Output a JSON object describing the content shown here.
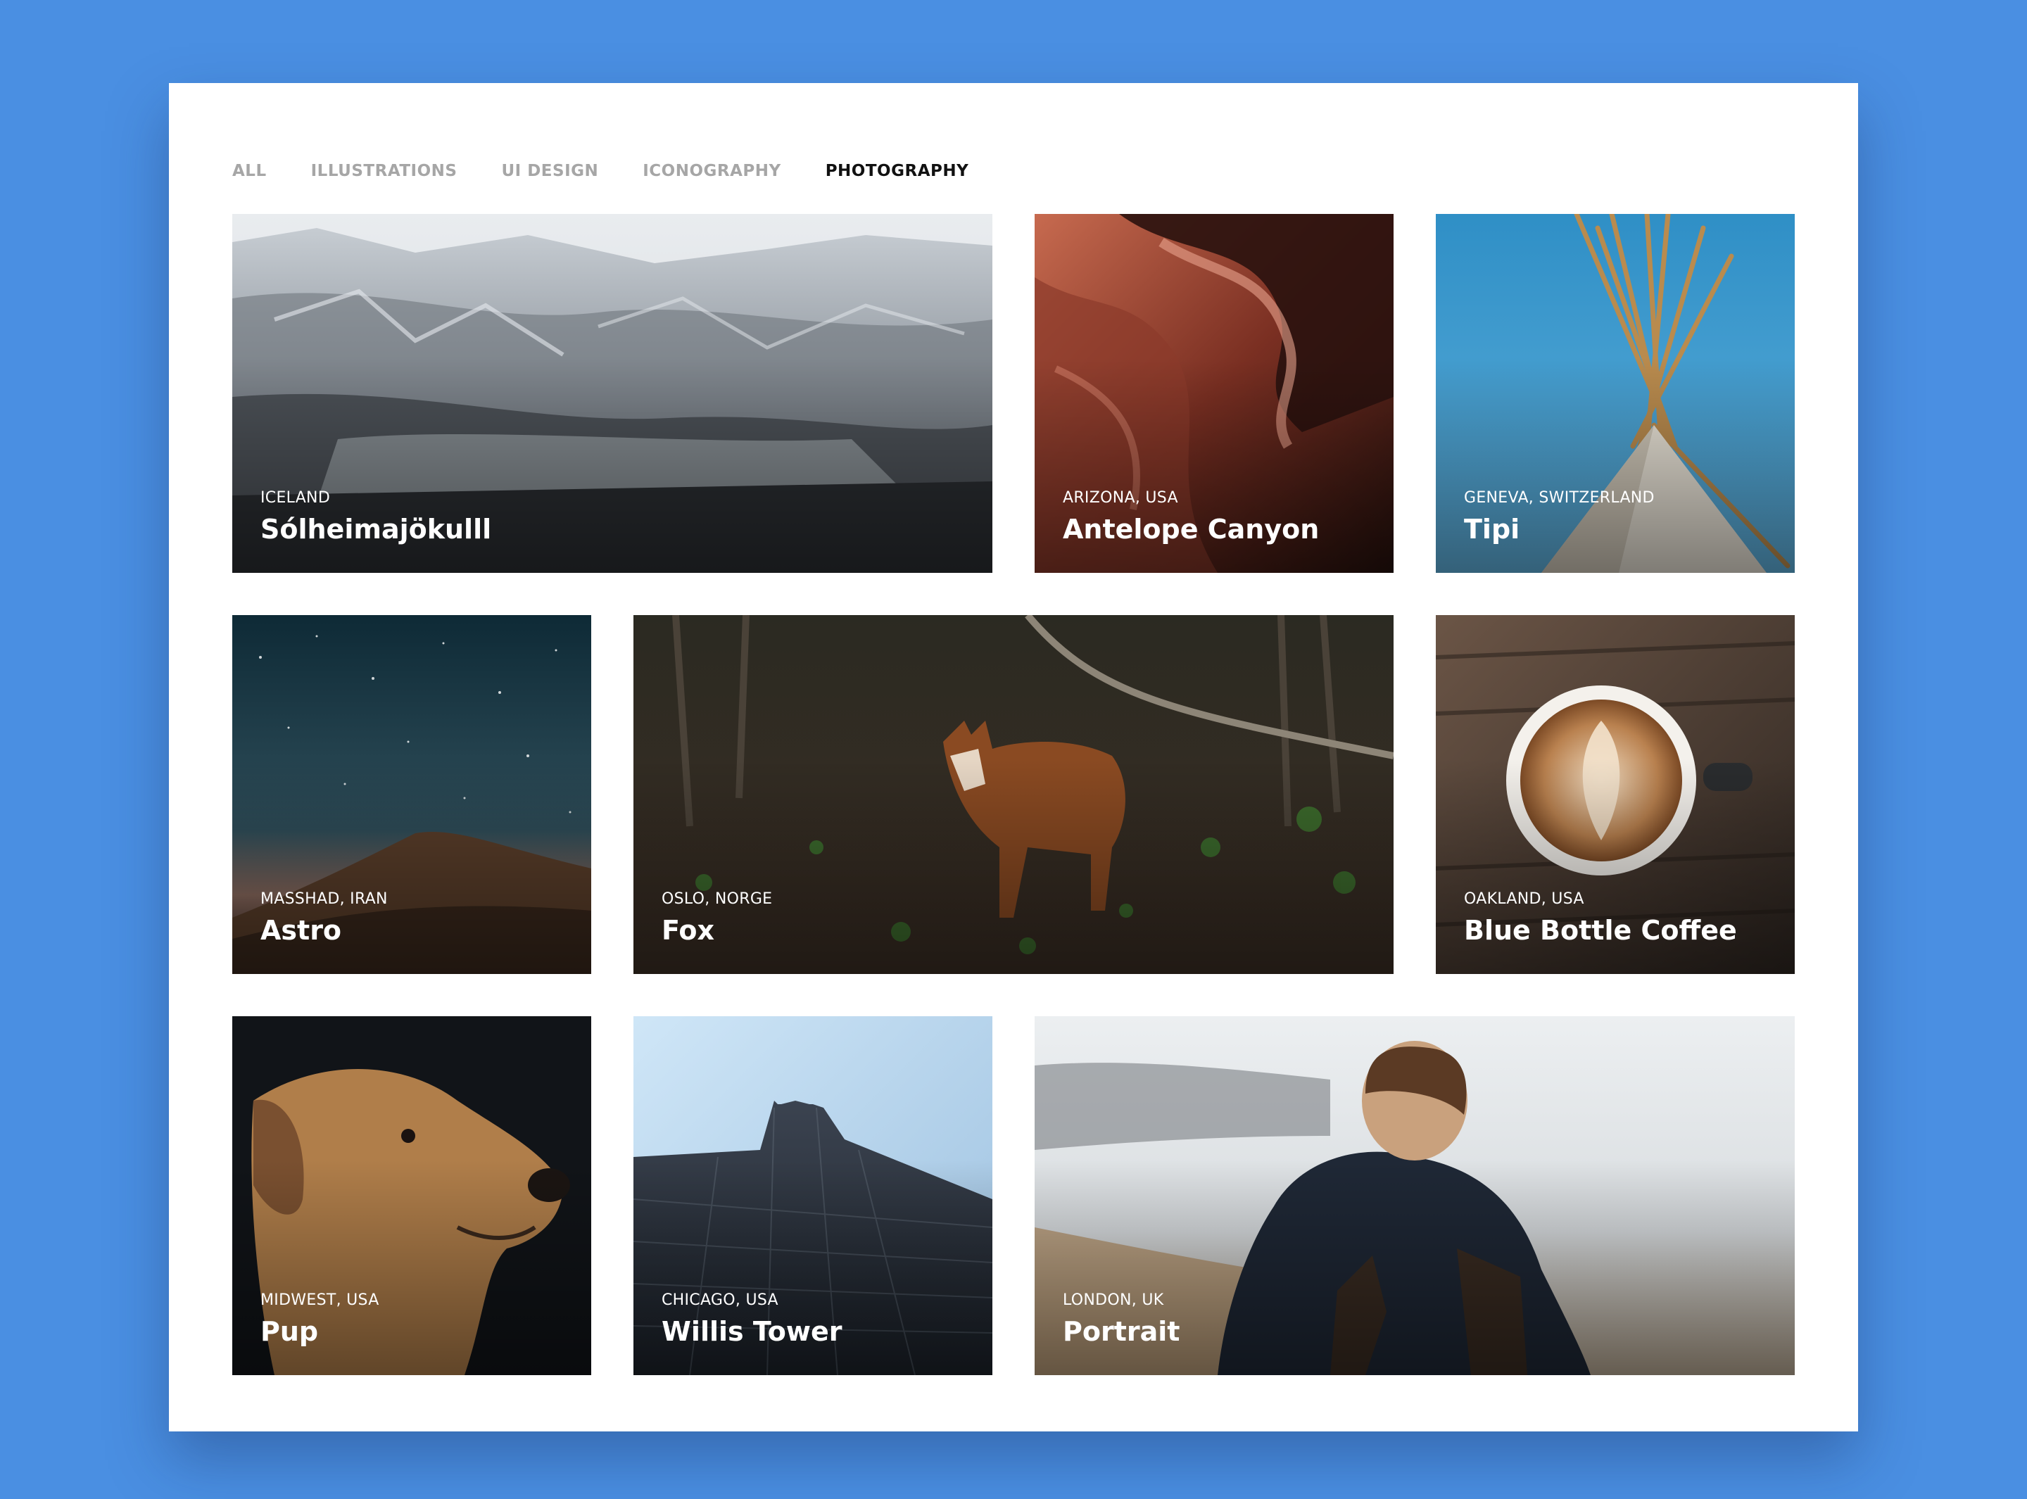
{
  "filters": {
    "tabs": [
      "ALL",
      "ILLUSTRATIONS",
      "UI DESIGN",
      "ICONOGRAPHY",
      "PHOTOGRAPHY"
    ],
    "active": "PHOTOGRAPHY"
  },
  "gallery": {
    "items": [
      {
        "location": "ICELAND",
        "title": "Sólheimajökulll"
      },
      {
        "location": "ARIZONA, USA",
        "title": "Antelope Canyon"
      },
      {
        "location": "GENEVA, SWITZERLAND",
        "title": "Tipi"
      },
      {
        "location": "MASSHAD, IRAN",
        "title": "Astro"
      },
      {
        "location": "OSLO, NORGE",
        "title": "Fox"
      },
      {
        "location": "OAKLAND, USA",
        "title": "Blue Bottle Coffee"
      },
      {
        "location": "MIDWEST, USA",
        "title": "Pup"
      },
      {
        "location": "CHICAGO, USA",
        "title": "Willis Tower"
      },
      {
        "location": "LONDON, UK",
        "title": "Portrait"
      }
    ]
  },
  "colors": {
    "background": "#4a8fe2",
    "panel": "#ffffff",
    "tab_inactive": "#a6a6a6",
    "tab_active": "#111111"
  }
}
